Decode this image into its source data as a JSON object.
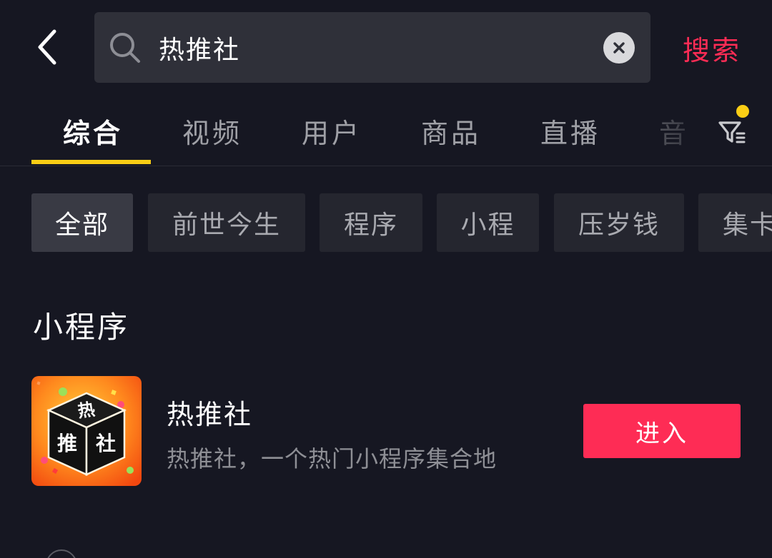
{
  "colors": {
    "background": "#161722",
    "search_bg": "#2f3039",
    "accent": "#fe2c55",
    "tab_indicator": "#face15",
    "chip_bg": "#25262f",
    "chip_active_bg": "#393a44"
  },
  "header": {
    "back_icon": "chevron-left-icon",
    "search": {
      "value": "热推社",
      "icon": "search-icon",
      "clear_icon": "close-icon"
    },
    "search_button_label": "搜索"
  },
  "tabs": {
    "items": [
      {
        "label": "综合",
        "active": true
      },
      {
        "label": "视频",
        "active": false
      },
      {
        "label": "用户",
        "active": false
      },
      {
        "label": "商品",
        "active": false
      },
      {
        "label": "直播",
        "active": false
      },
      {
        "label": "音",
        "active": false
      }
    ],
    "filter_icon": "filter-icon",
    "filter_has_badge": true
  },
  "chips": {
    "items": [
      {
        "label": "全部",
        "active": true
      },
      {
        "label": "前世今生",
        "active": false
      },
      {
        "label": "程序",
        "active": false
      },
      {
        "label": "小程",
        "active": false
      },
      {
        "label": "压岁钱",
        "active": false
      },
      {
        "label": "集卡",
        "active": false
      }
    ]
  },
  "section": {
    "title": "小程序",
    "app": {
      "name": "热推社",
      "description": "热推社，一个热门小程序集合地",
      "logo_glyphs": [
        "热",
        "推",
        "社"
      ],
      "enter_label": "进入"
    }
  }
}
